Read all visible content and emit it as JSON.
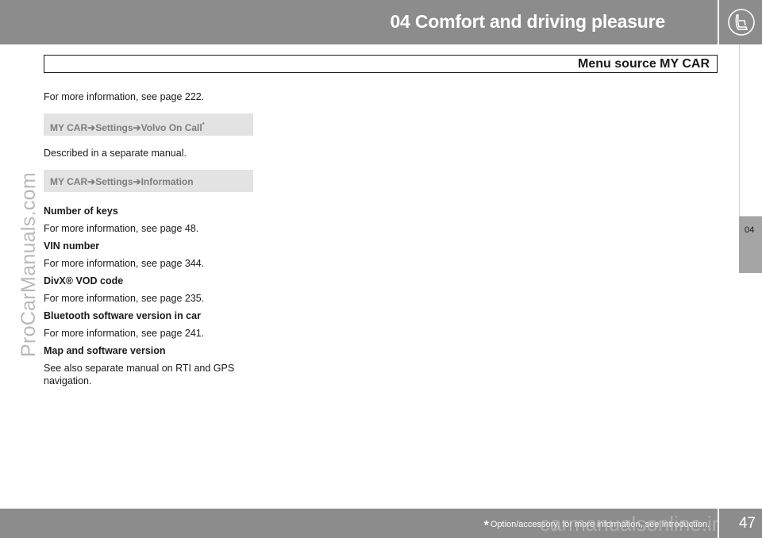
{
  "header": {
    "title": "04 Comfort and driving pleasure",
    "icon": "seat-icon"
  },
  "section": {
    "title": "Menu source MY CAR"
  },
  "side_tab": {
    "label": "04"
  },
  "content": {
    "intro": "For more information, see page 222.",
    "path1": {
      "a": "MY CAR",
      "b": "Settings",
      "c": "Volvo On Call",
      "asterisk": "*"
    },
    "separate": "Described in a separate manual.",
    "path2": {
      "a": "MY CAR",
      "b": "Settings",
      "c": "Information"
    },
    "items": [
      {
        "heading": "Number of keys",
        "text": "For more information, see page 48."
      },
      {
        "heading": "VIN number",
        "text": "For more information, see page 344."
      },
      {
        "heading": "DivX® VOD code",
        "text": "For more information, see page 235."
      },
      {
        "heading": "Bluetooth software version in car",
        "text": "For more information, see page 241."
      },
      {
        "heading": "Map and software version",
        "text": "See also separate manual on RTI and GPS navigation."
      }
    ]
  },
  "watermark": "ProCarManuals.com",
  "footer": {
    "star": "*",
    "note": "Option/accessory, for more information, see Introduction.",
    "page_number": "47",
    "watermark": "carmanualsonline.info"
  }
}
